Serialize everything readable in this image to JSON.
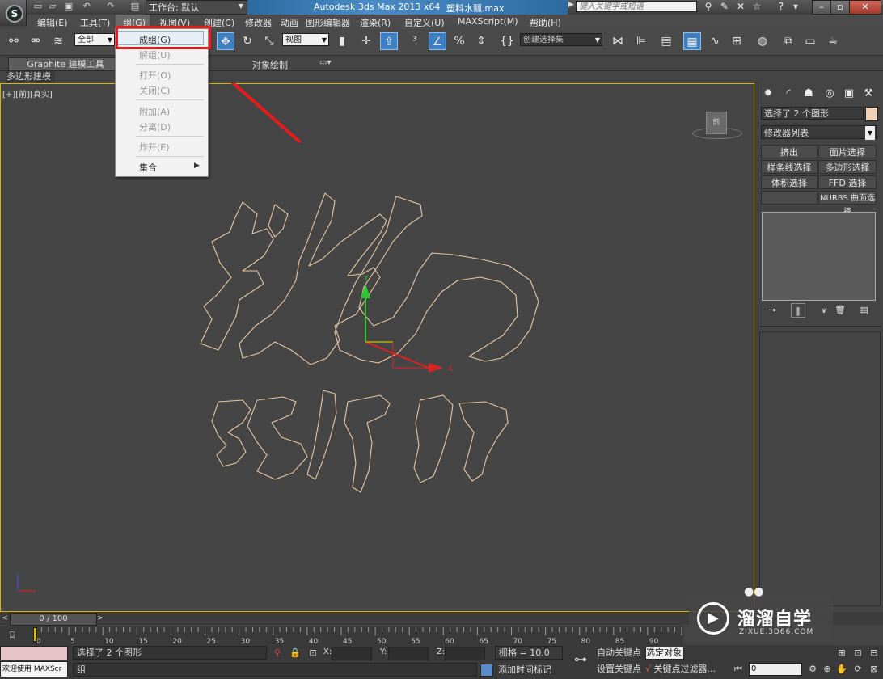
{
  "title_bar": {
    "workspace_label": "工作台: 默认",
    "app_title": "Autodesk 3ds Max  2013 x64",
    "file_name": "塑料水瓢.max",
    "search_placeholder": "键入关键字或短语"
  },
  "menu": {
    "items": [
      "编辑(E)",
      "工具(T)",
      "组(G)",
      "视图(V)",
      "创建(C)",
      "修改器",
      "动画",
      "图形编辑器",
      "渲染(R)",
      "自定义(U)",
      "MAXScript(M)",
      "帮助(H)"
    ]
  },
  "toolbar": {
    "selection_filter": "全部",
    "ref_coord": "视图",
    "named_selection": "创建选择集"
  },
  "ribbon": {
    "tab_graphite": "Graphite 建模工具",
    "tab_object_paint": "对象绘制",
    "sub_polygon": "多边形建模"
  },
  "viewport": {
    "label": "[+][前][真实]",
    "viewcube_face": "前"
  },
  "group_menu": {
    "items": [
      "成组(G)",
      "解组(U)",
      "打开(O)",
      "关闭(C)",
      "附加(A)",
      "分离(D)",
      "炸开(E)",
      "集合"
    ],
    "highlighted": "成组(G)"
  },
  "command_panel": {
    "selection_name": "选择了 2 个图形",
    "selection_color": "#f2d2b6",
    "modifier_list": "修改器列表",
    "buttons": [
      "挤出",
      "面片选择",
      "样条线选择",
      "多边形选择",
      "体积选择",
      "FFD 选择",
      "",
      "NURBS 曲面选择"
    ]
  },
  "timeline": {
    "frame_range": "0 / 100",
    "ticks": [
      "0",
      "5",
      "10",
      "15",
      "20",
      "25",
      "30",
      "35",
      "40",
      "45",
      "50",
      "55",
      "60",
      "65",
      "70",
      "75",
      "80",
      "85",
      "90",
      "95"
    ]
  },
  "status": {
    "maxscript": "欢迎使用 MAXScr",
    "selection": "选择了 2 个图形",
    "prompt": "组",
    "coord_x": "X:",
    "coord_y": "Y:",
    "coord_z": "Z:",
    "grid": "栅格 = 10.0",
    "add_time_tag": "添加时间标记",
    "auto_key": "自动关键点",
    "set_key": "设置关键点",
    "selected_objects": "选定对象",
    "key_filters": "关键点过滤器...",
    "current_frame": "0"
  },
  "watermark": {
    "brand": "溜溜自学",
    "url": "ZIXUE.3D66.COM"
  },
  "colors": {
    "accent_red": "#e51c1c",
    "shape_outline": "#e8c8a6",
    "viewport_border": "#d9b700"
  }
}
